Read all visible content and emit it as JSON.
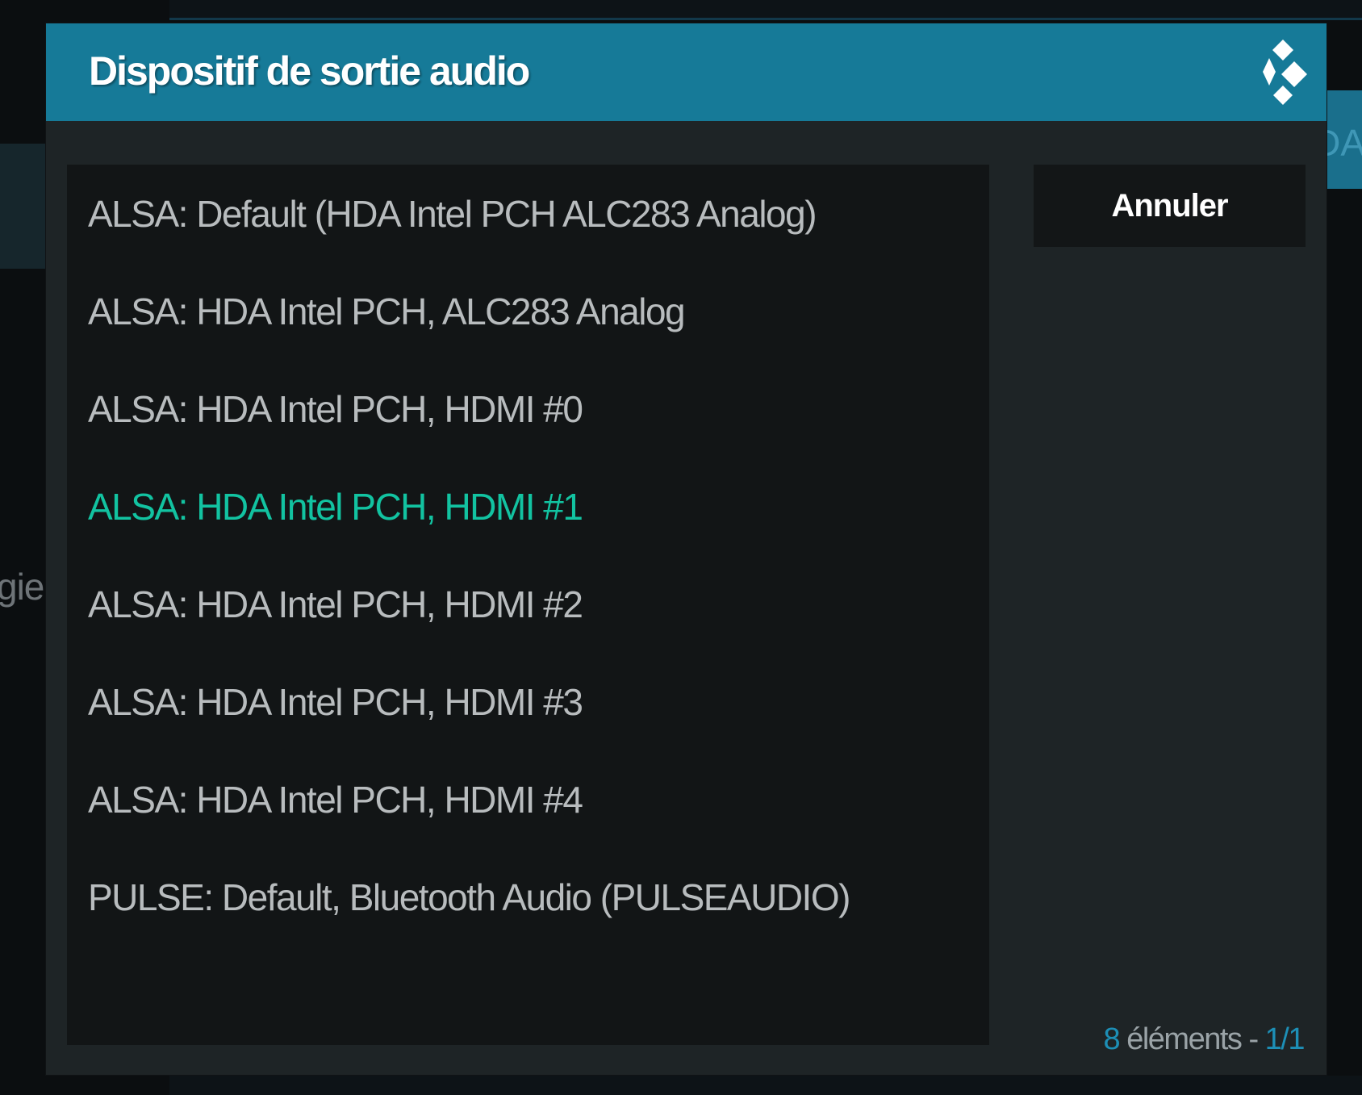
{
  "background": {
    "left_fragment": "gie",
    "right_fragment": "DA"
  },
  "dialog": {
    "title": "Dispositif de sortie audio",
    "logo_icon": "kodi-logo-icon",
    "cancel_label": "Annuler",
    "items": [
      {
        "label": "ALSA: Default (HDA Intel PCH ALC283 Analog)",
        "focused": false
      },
      {
        "label": "ALSA: HDA Intel PCH, ALC283 Analog",
        "focused": false
      },
      {
        "label": "ALSA: HDA Intel PCH, HDMI #0",
        "focused": false
      },
      {
        "label": "ALSA: HDA Intel PCH, HDMI #1",
        "focused": true
      },
      {
        "label": "ALSA: HDA Intel PCH, HDMI #2",
        "focused": false
      },
      {
        "label": "ALSA: HDA Intel PCH, HDMI #3",
        "focused": false
      },
      {
        "label": "ALSA: HDA Intel PCH, HDMI #4",
        "focused": false
      },
      {
        "label": "PULSE: Default, Bluetooth Audio (PULSEAUDIO)",
        "focused": false
      }
    ],
    "footer": {
      "count": "8",
      "items_text": " éléments - ",
      "page": "1/1"
    }
  },
  "colors": {
    "header": "#167a98",
    "dialog_background": "#1e2426",
    "list_background": "#121516",
    "item_text": "#b8bcbe",
    "item_focused": "#12c3a1",
    "accent": "#1d8fb6"
  }
}
